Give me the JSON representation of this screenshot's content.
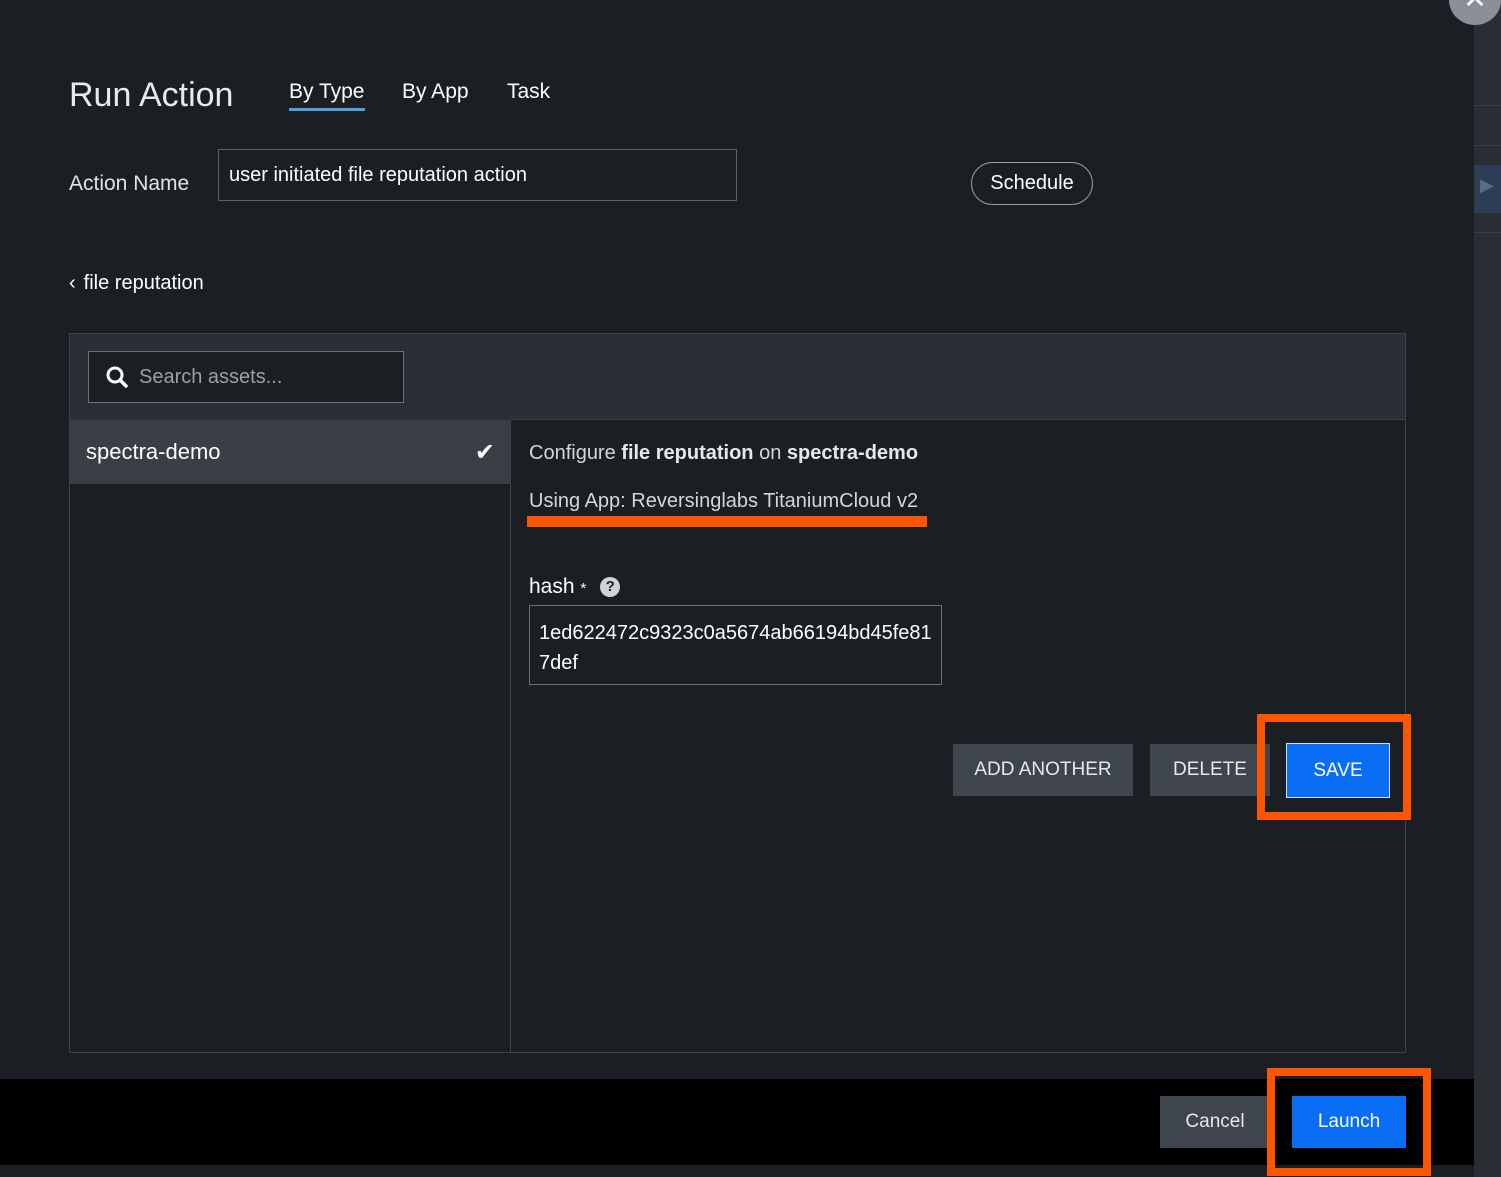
{
  "dialog": {
    "title": "Run Action",
    "tabs": [
      {
        "label": "By Type",
        "active": true
      },
      {
        "label": "By App"
      },
      {
        "label": "Task"
      }
    ],
    "action_name_label": "Action Name",
    "action_name_value": "user initiated file reputation action",
    "schedule_label": "Schedule",
    "back_label": "file reputation"
  },
  "assets": {
    "search_placeholder": "Search assets...",
    "items": [
      {
        "name": "spectra-demo",
        "selected": true
      }
    ]
  },
  "config": {
    "prefix": "Configure",
    "action": "file reputation",
    "on": "on",
    "asset": "spectra-demo",
    "using_app": "Using App: Reversinglabs TitaniumCloud v2",
    "hash_label": "hash",
    "required_mark": "*",
    "hash_value": "1ed622472c9323c0a5674ab66194bd45fe817def",
    "add_another": "ADD ANOTHER",
    "delete": "DELETE",
    "save": "SAVE"
  },
  "footer": {
    "cancel": "Cancel",
    "launch": "Launch"
  },
  "colors": {
    "accent": "#0a6ef5",
    "highlight": "#ff5500",
    "tab_underline": "#4aa3df"
  }
}
